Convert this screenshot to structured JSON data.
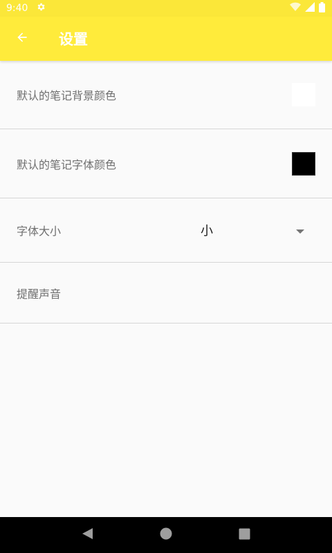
{
  "status_bar": {
    "time": "9:40",
    "icons": [
      "gear-icon",
      "wifi-icon",
      "signal-icon",
      "battery-icon"
    ]
  },
  "app_bar": {
    "title": "设置",
    "back_icon": "back-arrow-icon",
    "background": "#ffeb3b"
  },
  "settings": {
    "items": [
      {
        "label": "默认的笔记背景颜色",
        "swatch_color": "#ffffff"
      },
      {
        "label": "默认的笔记字体颜色",
        "swatch_color": "#000000"
      },
      {
        "label": "字体大小",
        "selected_value": "小"
      },
      {
        "label": "提醒声音"
      }
    ]
  },
  "nav_bar": {
    "icons": [
      "back-triangle-icon",
      "home-circle-icon",
      "recents-square-icon"
    ]
  }
}
